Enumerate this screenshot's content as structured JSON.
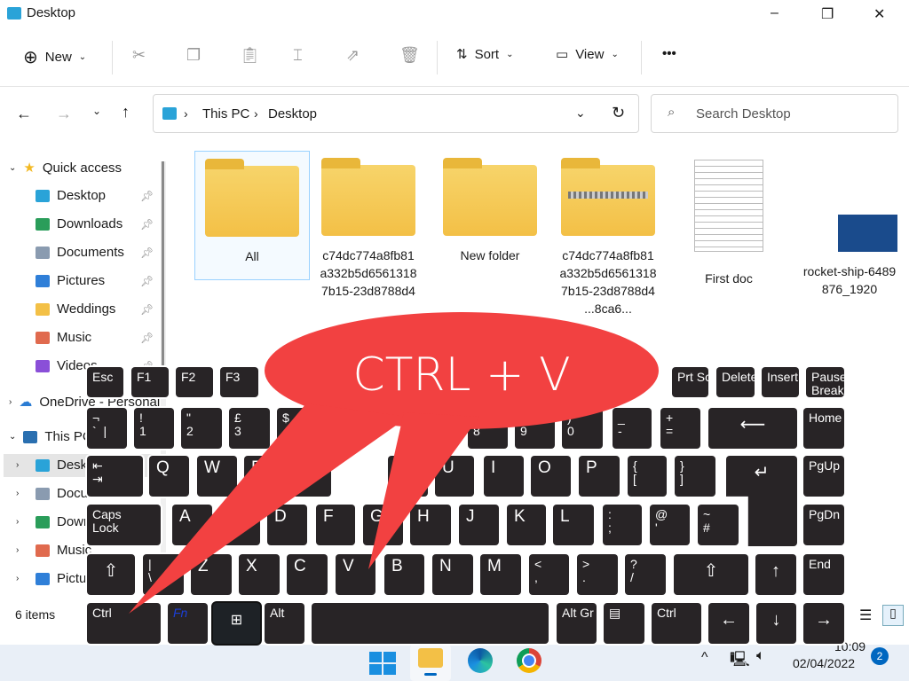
{
  "window": {
    "title": "Desktop",
    "minimize": "–",
    "maximize": "❐",
    "close": "✕"
  },
  "toolbar": {
    "new": "New",
    "sort": "Sort",
    "view": "View",
    "more": "•••"
  },
  "address": {
    "path": [
      "This PC",
      "Desktop"
    ],
    "search_placeholder": "Search Desktop"
  },
  "nav": {
    "quick_access": "Quick access",
    "quick_items": [
      {
        "label": "Desktop",
        "color": "#2aa3d8"
      },
      {
        "label": "Downloads",
        "color": "#2a9d5a"
      },
      {
        "label": "Documents",
        "color": "#8a9bb0"
      },
      {
        "label": "Pictures",
        "color": "#2f7fd8"
      },
      {
        "label": "Weddings",
        "color": "#f3c046"
      },
      {
        "label": "Music",
        "color": "#e06a4e"
      },
      {
        "label": "Videos",
        "color": "#8a4fd8"
      }
    ],
    "onedrive": "OneDrive - Personal",
    "this_pc": "This PC",
    "pc_items": [
      {
        "label": "Desktop",
        "color": "#2aa3d8"
      },
      {
        "label": "Documents",
        "color": "#8a9bb0"
      },
      {
        "label": "Downloads",
        "color": "#2a9d5a"
      },
      {
        "label": "Music",
        "color": "#e06a4e"
      },
      {
        "label": "Pictures",
        "color": "#2f7fd8"
      }
    ]
  },
  "files": [
    {
      "name": "All",
      "type": "folder"
    },
    {
      "name": "c74dc774a8fb81\na332b5d6561318\n7b15-23d8788d4",
      "type": "folder"
    },
    {
      "name": "New folder",
      "type": "folder"
    },
    {
      "name": "c74dc774a8fb81\na332b5d6561318\n7b15-23d8788d4\n...8ca6...",
      "type": "zip"
    },
    {
      "name": "First doc",
      "type": "document"
    },
    {
      "name": "rocket-ship-6489\n876_1920",
      "type": "image"
    }
  ],
  "status": {
    "count": "6 items"
  },
  "callout": "CTRL + V",
  "keyboard": {
    "rows": [
      [
        "Esc",
        "F1",
        "F2",
        "F3",
        "Prt Sc",
        "Delete",
        "Insert",
        "Pause\nBreak"
      ],
      [
        "¬\n`  |",
        "!\n1",
        "\"\n2",
        "£\n3",
        "$\n4",
        "%\n5",
        "*\n8",
        "(\n9",
        ")\n0",
        "_\n-",
        "+\n=",
        "⟵",
        "Home"
      ],
      [
        "⇤\n⇥",
        "Q",
        "W",
        "E",
        "R",
        "Y",
        "U",
        "I",
        "O",
        "P",
        "{\n[",
        "}\n]",
        "↵",
        "PgUp"
      ],
      [
        "Caps\nLock",
        "A",
        "S",
        "D",
        "F",
        "G",
        "H",
        "J",
        "K",
        "L",
        ":\n;",
        "@\n'",
        "~\n#",
        "PgDn"
      ],
      [
        "⇧",
        "|\n\\",
        "Z",
        "X",
        "C",
        "V",
        "B",
        "N",
        "M",
        "<\n,",
        ">\n.",
        "?\n/",
        "⇧",
        "↑",
        "End"
      ],
      [
        "Ctrl",
        "Fn",
        "⊞",
        "Alt",
        "",
        "Alt Gr",
        "▤",
        "Ctrl",
        "←",
        "↓",
        "→"
      ]
    ]
  },
  "taskbar": {
    "time": "10:09",
    "date": "02/04/2022",
    "notifications": "2"
  },
  "colors": {
    "callout": "#f24141",
    "key": "#282426",
    "accent": "#0067c0"
  }
}
